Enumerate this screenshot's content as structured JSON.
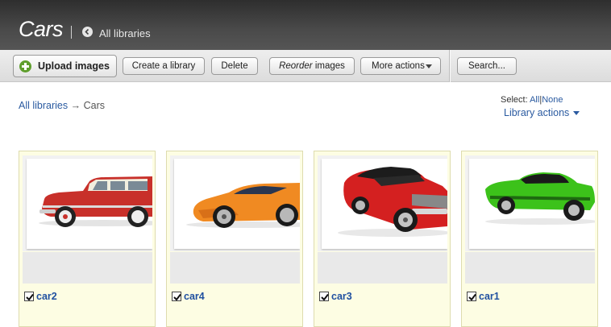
{
  "header": {
    "title": "Cars",
    "back_label": "All libraries"
  },
  "toolbar": {
    "upload_label": "Upload images",
    "create_label": "Create a library",
    "delete_label": "Delete",
    "reorder_word": "Reorder",
    "reorder_suffix": " images",
    "more_label": "More actions",
    "search_label": "Search..."
  },
  "breadcrumb": {
    "root": "All libraries",
    "arrow": "→",
    "current": "Cars"
  },
  "selection": {
    "prefix": "Select:",
    "all": "All",
    "divider": "|",
    "none": "None",
    "library_actions": "Library actions"
  },
  "cards": [
    {
      "name": "car2",
      "checked": true,
      "color": "#c8302a"
    },
    {
      "name": "car4",
      "checked": true,
      "color": "#f08a22"
    },
    {
      "name": "car3",
      "checked": true,
      "color": "#d42020"
    },
    {
      "name": "car1",
      "checked": true,
      "color": "#3cc21a"
    }
  ],
  "colors": {
    "header_bg": "#3a3a3a",
    "link": "#2a5aa0",
    "card_bg": "#fdfde3",
    "upload_icon": "#5e9e2c"
  }
}
